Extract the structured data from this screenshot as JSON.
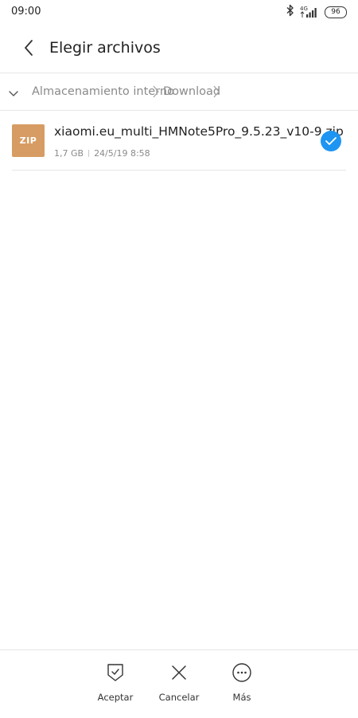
{
  "status_bar": {
    "time": "09:00",
    "network": "4G",
    "battery": "96"
  },
  "header": {
    "title": "Elegir archivos"
  },
  "breadcrumb": {
    "items": [
      "Almacenamiento interno",
      "Download"
    ]
  },
  "files": [
    {
      "icon_label": "ZIP",
      "name": "xiaomi.eu_multi_HMNote5Pro_9.5.23_v10-9.zip",
      "size": "1,7 GB",
      "date": "24/5/19 8:58",
      "selected": true
    }
  ],
  "bottom_actions": [
    {
      "label": "Aceptar",
      "icon": "accept-icon"
    },
    {
      "label": "Cancelar",
      "icon": "close-icon"
    },
    {
      "label": "Más",
      "icon": "more-icon"
    }
  ],
  "colors": {
    "accent": "#1e95f2",
    "zip_icon": "#d79c63",
    "secondary_text": "#8a8a8a"
  }
}
